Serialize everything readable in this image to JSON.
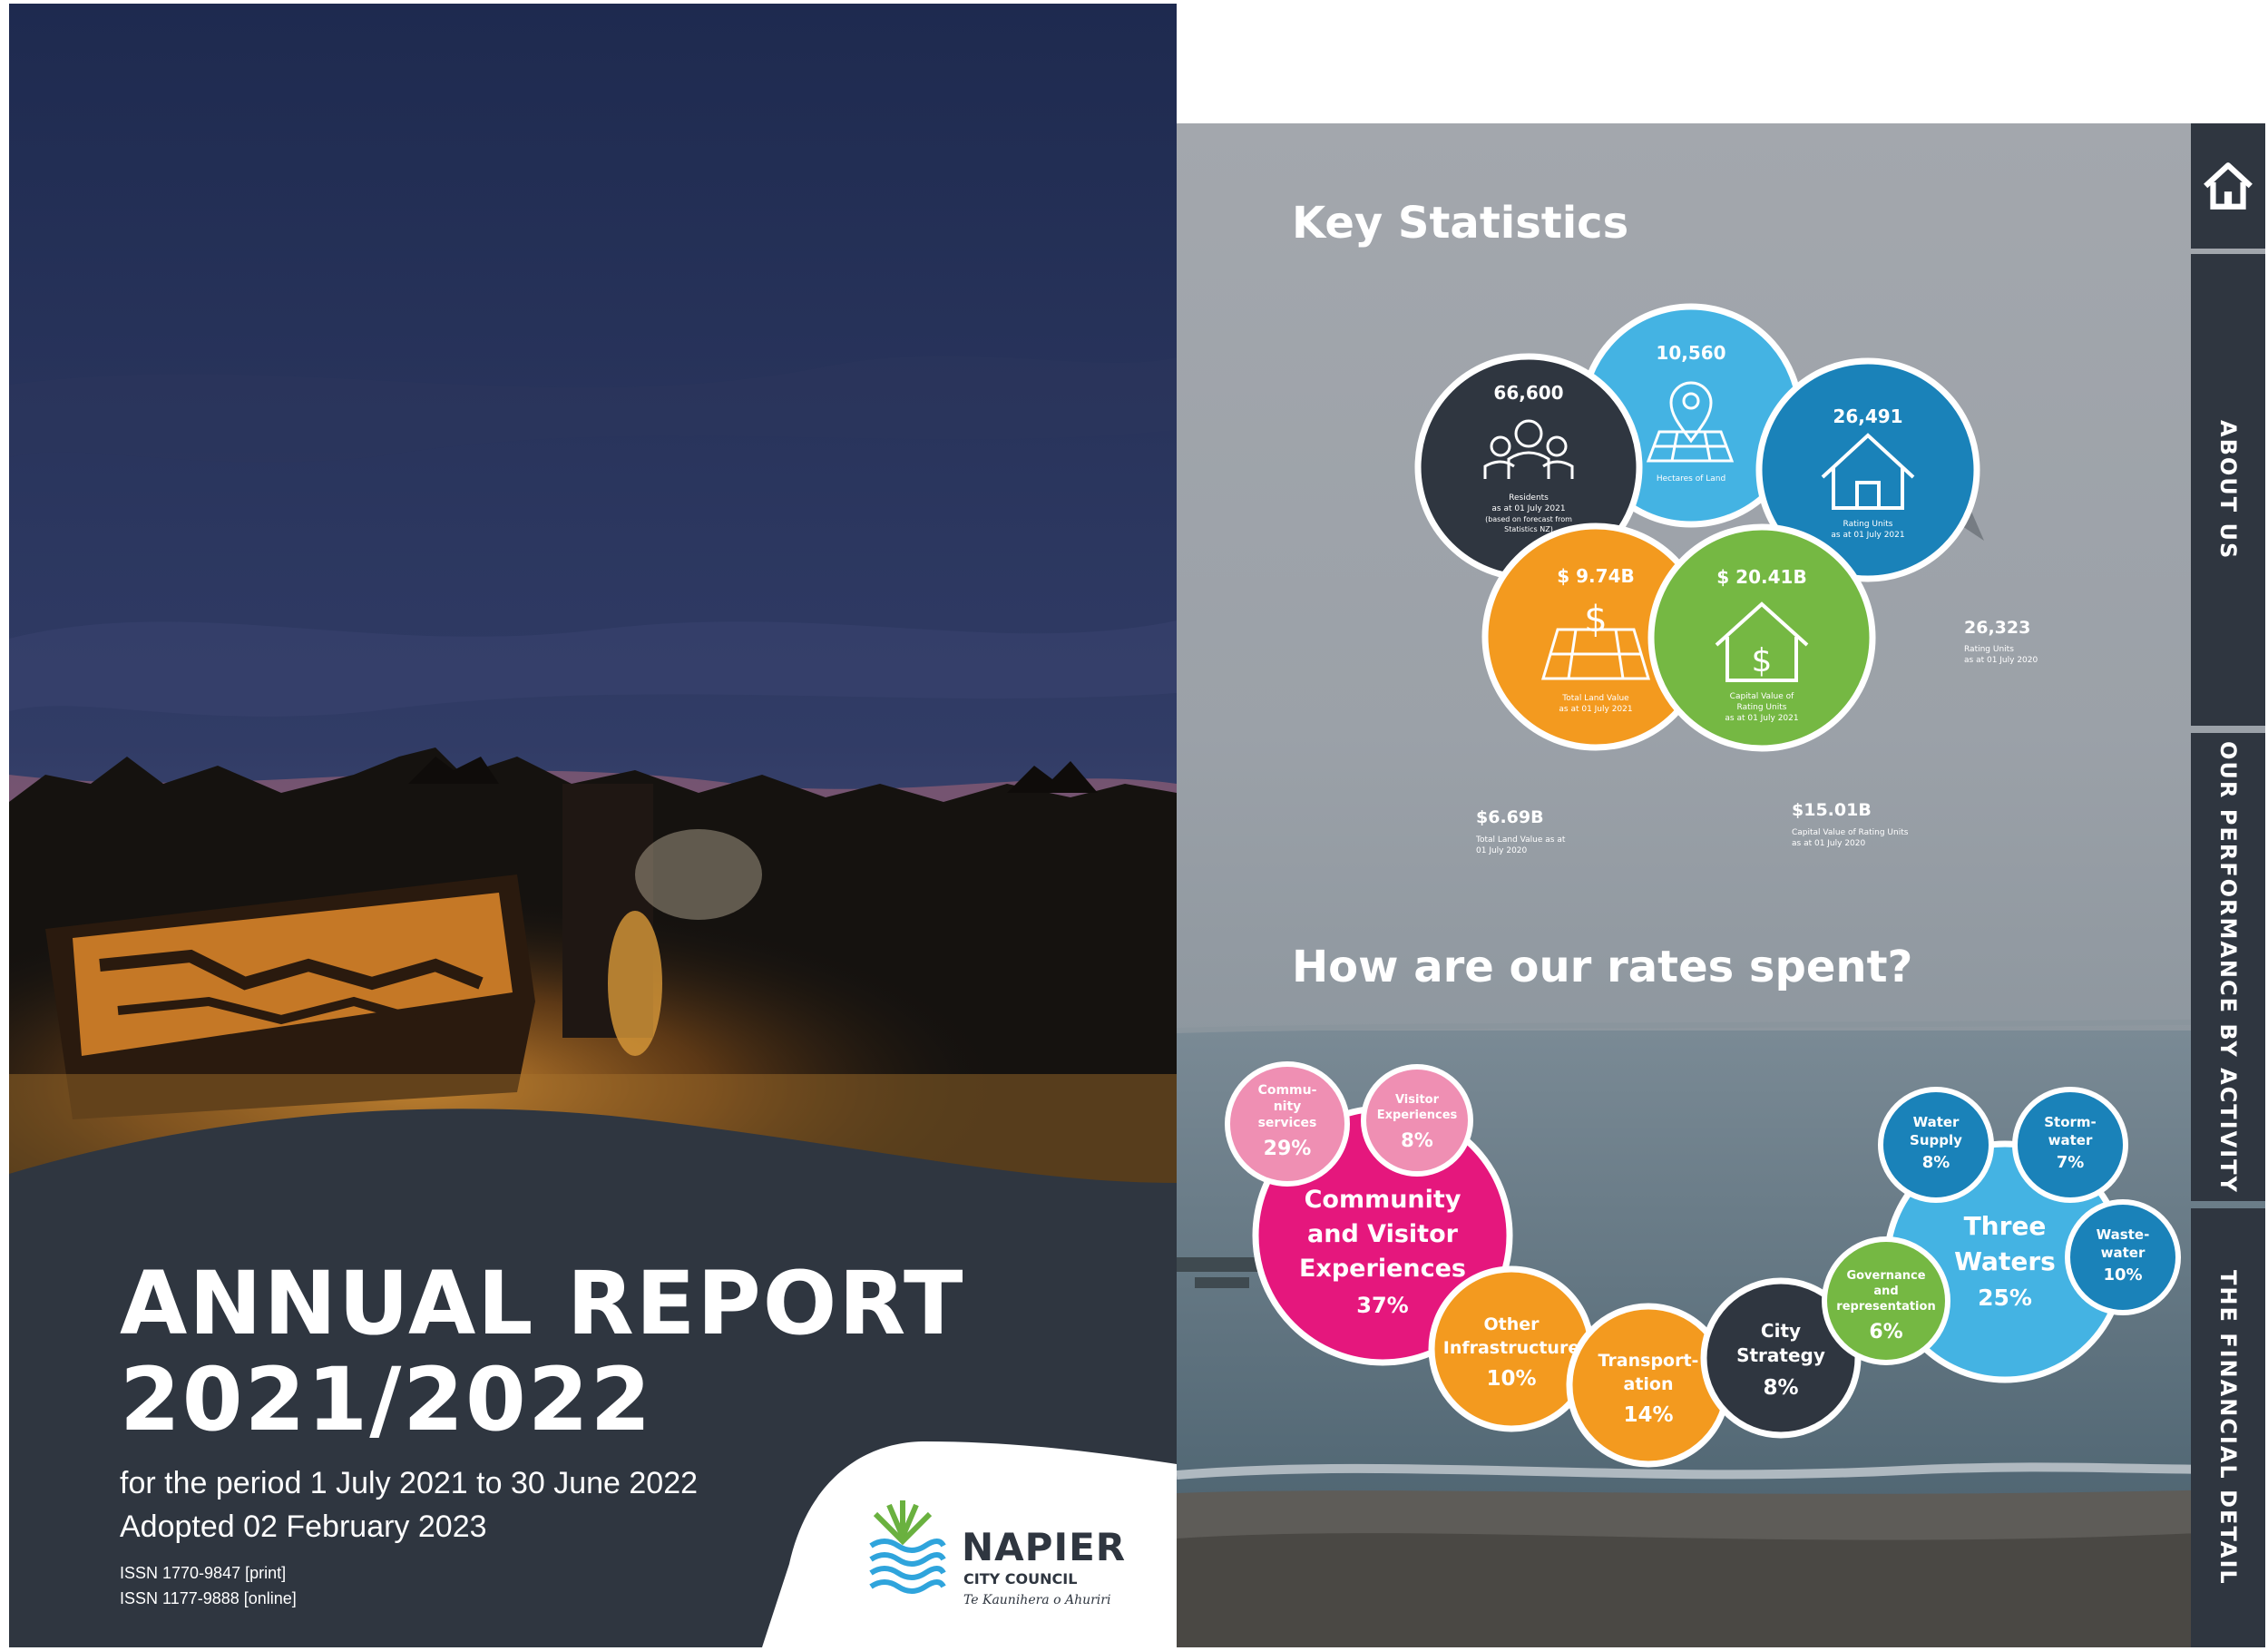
{
  "cover": {
    "title_line1": "ANNUAL REPORT",
    "title_line2": "2021/2022",
    "period": "for the period 1 July 2021 to 30 June 2022",
    "adopted": "Adopted 02 February 2023",
    "issn_print": "ISSN 1770-9847 [print]",
    "issn_online": "ISSN 1177-9888 [online]",
    "logo_name": "NAPIER",
    "logo_council": "CITY COUNCIL",
    "logo_tagline": "Te Kaunihera o Ahuriri"
  },
  "key_statistics": {
    "title": "Key Statistics",
    "residents": {
      "value": "66,600",
      "line1": "Residents",
      "line2": "as at 01 July 2021",
      "line3": "(based on forecast from",
      "line4": "Statistics NZ)"
    },
    "land": {
      "value": "10,560",
      "label": "Hectares of Land"
    },
    "rating_units": {
      "value": "26,491",
      "line1": "Rating Units",
      "line2": "as at 01 July 2021"
    },
    "land_value": {
      "value": "$ 9.74B",
      "line1": "Total Land Value",
      "line2": "as at 01 July 2021"
    },
    "capital_value": {
      "value": "$ 20.41B",
      "line1": "Capital Value of",
      "line2": "Rating Units",
      "line3": "as at 01 July 2021"
    },
    "rating_units_2020": {
      "value": "26,323",
      "line1": "Rating Units",
      "line2": "as at 01 July 2020"
    },
    "land_value_2020": {
      "value": "$6.69B",
      "line1": "Total Land Value as at",
      "line2": "01 July 2020"
    },
    "capital_value_2020": {
      "value": "$15.01B",
      "line1": "Capital Value of Rating Units",
      "line2": "as at 01 July 2020"
    }
  },
  "rates": {
    "title": "How are our rates spent?",
    "community_services": {
      "line1": "Commu-",
      "line2": "nity",
      "line3": "services",
      "pct": "29%"
    },
    "visitor_experiences": {
      "line1": "Visitor",
      "line2": "Experiences",
      "pct": "8%"
    },
    "community_visitor": {
      "line1": "Community",
      "line2": "and Visitor",
      "line3": "Experiences",
      "pct": "37%"
    },
    "other_infrastructure": {
      "line1": "Other",
      "line2": "Infrastructure",
      "pct": "10%"
    },
    "transportation": {
      "line1": "Transport-",
      "line2": "ation",
      "pct": "14%"
    },
    "city_strategy": {
      "line1": "City",
      "line2": "Strategy",
      "pct": "8%"
    },
    "governance": {
      "line1": "Governance",
      "line2": "and",
      "line3": "representation",
      "pct": "6%"
    },
    "three_waters": {
      "line1": "Three",
      "line2": "Waters",
      "pct": "25%"
    },
    "water_supply": {
      "line1": "Water",
      "line2": "Supply",
      "pct": "8%"
    },
    "stormwater": {
      "line1": "Storm-",
      "line2": "water",
      "pct": "7%"
    },
    "wastewater": {
      "line1": "Waste-",
      "line2": "water",
      "pct": "10%"
    }
  },
  "nav": {
    "home_icon": "home-icon",
    "about": "ABOUT US",
    "performance": "OUR PERFORMANCE BY ACTIVITY",
    "financial": "THE FINANCIAL DETAIL"
  },
  "colors": {
    "charcoal": "#2f3640",
    "sky_blue": "#44b3e3",
    "mid_blue": "#1a82b9",
    "orange": "#f39a1f",
    "green": "#75b843",
    "magenta": "#e5177d",
    "pink": "#ef8fb3"
  }
}
